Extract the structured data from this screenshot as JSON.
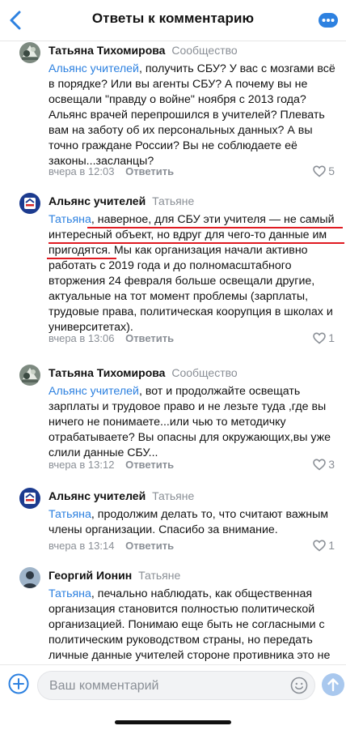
{
  "header": {
    "title": "Ответы к комментарию"
  },
  "comments": [
    {
      "author": "Татьяна Тихомирова",
      "meta": "Сообщество",
      "mention": "Альянс учителей",
      "text": ", получить СБУ? У вас с мозгами всё в порядке? Или вы агенты СБУ? А почему вы не освещали \"правду о войне\"  ноября с 2013 года? Альянс врачей перепрошился в учителей? Плевать вам на заботу об их персональных данных? А вы точно граждане России? Вы не соблюдаете её законы...засланцы?",
      "time": "вчера в 12:03",
      "reply": "Ответить",
      "likes": "5"
    },
    {
      "author": "Альянс учителей",
      "meta": "Татьяне",
      "mention": "Татьяна",
      "text": ", наверное, для СБУ эти учителя — не самый интересный объект, но вдруг для чего-то данные им пригодятся. Мы как организация начали активно работать с 2019 года и до полномасштабного вторжения 24 февраля больше освещали другие, актуальные на тот момент проблемы (зарплаты, трудовые права, политическая коорупция в школах и университетах).",
      "time": "вчера в 13:06",
      "reply": "Ответить",
      "likes": "1"
    },
    {
      "author": "Татьяна Тихомирова",
      "meta": "Сообщество",
      "mention": "Альянс учителей",
      "text": ", вот и продолжайте освещать зарплаты и трудовое право и не лезьте туда ,где вы ничего не понимаете...или чью то методичку отрабатываете? Вы опасны для окружающих,вы уже слили данные СБУ...",
      "time": "вчера в 13:12",
      "reply": "Ответить",
      "likes": "3"
    },
    {
      "author": "Альянс учителей",
      "meta": "Татьяне",
      "mention": "Татьяна",
      "text": ", продолжим делать то, что считают важным члены организации. Спасибо за внимание.",
      "time": "вчера в 13:14",
      "reply": "Ответить",
      "likes": "1"
    },
    {
      "author": "Георгий Ионин",
      "meta": "Татьяне",
      "mention": "Татьяна",
      "text": ", печально наблюдать, как общественная организация становится полностью политической организацией. Понимаю еще быть не согласными с политическим руководством страны, но передать личные данные учителей стороне противника это не просто преступно, но и жестоко.",
      "time": "",
      "reply": "",
      "likes": ""
    }
  ],
  "composer": {
    "placeholder": "Ваш комментарий"
  },
  "colors": {
    "accent": "#2d81e0",
    "underline": "#e01b22",
    "muted": "#8a8f96"
  },
  "icons": [
    "back-arrow-icon",
    "more-dots-icon",
    "heart-icon",
    "plus-icon",
    "emoji-icon",
    "send-arrow-icon"
  ]
}
